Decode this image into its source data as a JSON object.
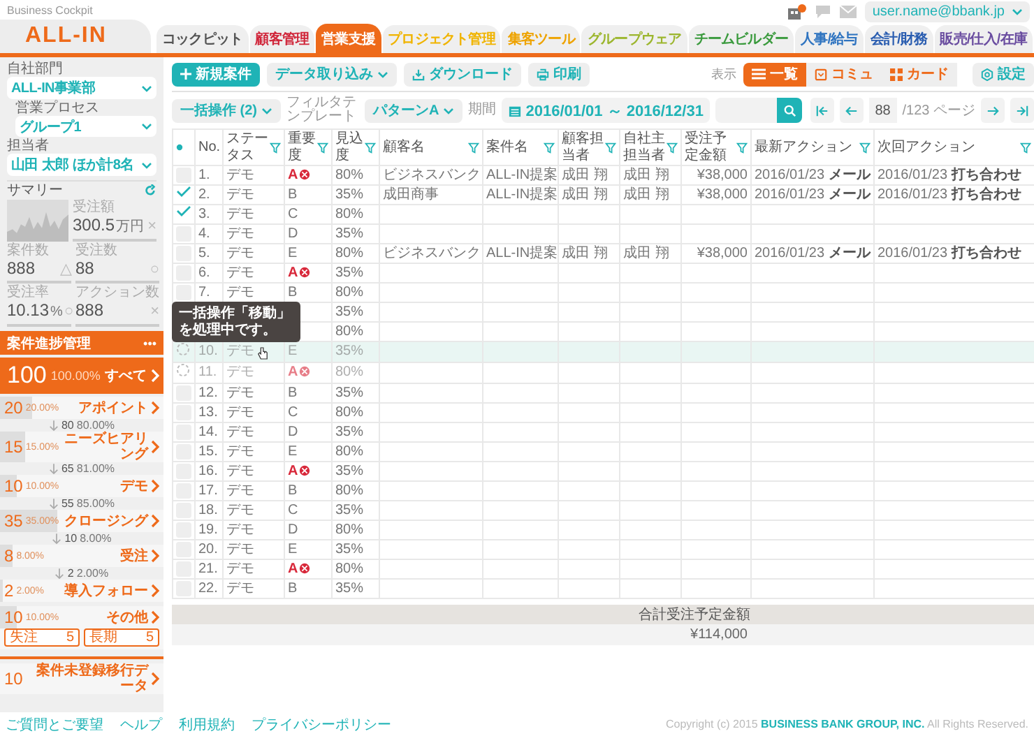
{
  "app": {
    "product": "Business Cockpit",
    "logo": "ALL-IN"
  },
  "tabs": [
    {
      "label": "コックピット",
      "selected": false,
      "color": "#555555"
    },
    {
      "label": "顧客管理",
      "selected": false,
      "color": "#d0263a"
    },
    {
      "label": "営業支援",
      "selected": true,
      "color": "#ee6a1a"
    },
    {
      "label": "プロジェクト管理",
      "selected": false,
      "color": "#f0b400"
    },
    {
      "label": "集客ツール",
      "selected": false,
      "color": "#eea300"
    },
    {
      "label": "グループウェア",
      "selected": false,
      "color": "#9cb62e"
    },
    {
      "label": "チームビルダー",
      "selected": false,
      "color": "#3a9a3d"
    },
    {
      "label": "人事/給与",
      "selected": false,
      "color": "#2f74c0"
    },
    {
      "label": "会計/財務",
      "selected": false,
      "color": "#2a5db0"
    },
    {
      "label": "販売/仕入/在庫",
      "selected": false,
      "color": "#6a4da0"
    }
  ],
  "user": "user.name@bbank.jp",
  "sidebar": {
    "filters": [
      {
        "label": "自社部門",
        "value": "ALL-IN事業部",
        "kind": "main"
      },
      {
        "label": "営業プロセス",
        "value": "グループ1",
        "kind": "sub"
      },
      {
        "label": "担当者",
        "value": "山田 太郎 ほか計8名",
        "kind": "main"
      }
    ],
    "summary": {
      "title": "サマリー",
      "amount": {
        "label": "受注額",
        "value": "300.5",
        "unit": "万円",
        "mark": "×"
      },
      "stats": [
        {
          "label": "案件数",
          "value": "888",
          "mark": "△"
        },
        {
          "label": "受注数",
          "value": "88",
          "mark": "○"
        },
        {
          "label": "受注率",
          "value": "10.13",
          "unit": "%",
          "mark": "○"
        },
        {
          "label": "アクション数",
          "value": "888",
          "mark": "×"
        }
      ]
    },
    "progress": {
      "title": "案件進捗管理",
      "menu": "•••",
      "total": {
        "count": "100",
        "percent": "100.00%",
        "label": "すべて"
      },
      "stages": [
        {
          "count": "20",
          "percent": "20.00%",
          "label": "アポイント",
          "level": 0.2,
          "next": {
            "count": "80",
            "percent": "80.00%"
          }
        },
        {
          "count": "15",
          "percent": "15.00%",
          "label": "ニーズヒアリング",
          "level": 0.15,
          "next": {
            "count": "65",
            "percent": "81.00%"
          }
        },
        {
          "count": "10",
          "percent": "10.00%",
          "label": "デモ",
          "level": 0.1,
          "next": {
            "count": "55",
            "percent": "85.00%"
          }
        },
        {
          "count": "35",
          "percent": "35.00%",
          "label": "クロージング",
          "level": 0.35,
          "next": {
            "count": "10",
            "percent": "8.00%"
          }
        },
        {
          "count": "8",
          "percent": "8.00%",
          "label": "受注",
          "level": 0.08,
          "next": {
            "count": "2",
            "percent": "2.00%"
          }
        },
        {
          "count": "2",
          "percent": "2.00%",
          "label": "導入フォロー",
          "level": 0.02
        },
        {
          "count": "10",
          "percent": "10.00%",
          "label": "その他",
          "level": 0.1,
          "subs": [
            {
              "label": "失注",
              "count": "5"
            },
            {
              "label": "長期",
              "count": "5"
            }
          ]
        }
      ],
      "unregistered": {
        "count": "10",
        "label": "案件未登録移行データ"
      }
    }
  },
  "toolbar": {
    "buttons": [
      {
        "label": "新規案件",
        "kind": "new"
      },
      {
        "label": "データ取り込み",
        "kind": "dropdown"
      },
      {
        "label": "ダウンロード",
        "kind": "download"
      },
      {
        "label": "印刷",
        "kind": "print"
      }
    ],
    "view_label": "表示",
    "views": [
      {
        "label": "一覧",
        "kind": "list",
        "selected": true
      },
      {
        "label": "コミュ",
        "kind": "comm",
        "selected": false
      },
      {
        "label": "カード",
        "kind": "card",
        "selected": false
      }
    ],
    "settings": "設定"
  },
  "filters": {
    "bulk": "一括操作 (2)",
    "template_label": "フィルタテンプレート",
    "template": "パターンA",
    "period_label": "期間",
    "period": "2016/01/01 ～ 2016/12/31",
    "page": "88",
    "page_total": "/123 ページ"
  },
  "table": {
    "columns": [
      {
        "kind": "select"
      },
      {
        "label": "No.",
        "filter": false
      },
      {
        "label": "ステータス",
        "filter": true
      },
      {
        "label": "重要度",
        "filter": true
      },
      {
        "label": "見込度",
        "filter": true
      },
      {
        "label": "顧客名",
        "filter": true
      },
      {
        "label": "案件名",
        "filter": true
      },
      {
        "label": "顧客担当者",
        "filter": true
      },
      {
        "label": "自社主担当者",
        "filter": true
      },
      {
        "label": "受注予定金額",
        "filter": true
      },
      {
        "label": "最新アクション",
        "filter": true
      },
      {
        "label": "次回アクション",
        "filter": true
      }
    ],
    "rows": [
      {
        "no": "1.",
        "status": "デモ",
        "grade": "A",
        "urgent": true,
        "prob": "80%",
        "customer": "ビジネスバンク",
        "project": "ALL-IN提案",
        "contact": "成田 翔",
        "owner": "成田 翔",
        "amount": "¥38,000",
        "last_action": "2016/01/23 **メール**",
        "next_action": "2016/01/23 **打ち合わせ**",
        "checked": false,
        "processing": false,
        "hovered": false
      },
      {
        "no": "2.",
        "status": "デモ",
        "grade": "B",
        "urgent": false,
        "prob": "35%",
        "customer": "成田商事",
        "project": "ALL-IN提案",
        "contact": "成田 翔",
        "owner": "成田 翔",
        "amount": "¥38,000",
        "last_action": "2016/01/23 **メール**",
        "next_action": "2016/01/23 **打ち合わせ**",
        "checked": true,
        "processing": false,
        "hovered": false
      },
      {
        "no": "3.",
        "status": "デモ",
        "grade": "C",
        "urgent": false,
        "prob": "80%",
        "checked": true,
        "processing": false,
        "hovered": false
      },
      {
        "no": "4.",
        "status": "デモ",
        "grade": "D",
        "urgent": false,
        "prob": "35%",
        "checked": false,
        "processing": false,
        "hovered": false
      },
      {
        "no": "5.",
        "status": "デモ",
        "grade": "E",
        "urgent": false,
        "prob": "80%",
        "customer": "ビジネスバンク",
        "project": "ALL-IN提案",
        "contact": "成田 翔",
        "owner": "成田 翔",
        "amount": "¥38,000",
        "last_action": "2016/01/23 **メール**",
        "next_action": "2016/01/23 **打ち合わせ**",
        "checked": false,
        "processing": false,
        "hovered": false
      },
      {
        "no": "6.",
        "status": "デモ",
        "grade": "A",
        "urgent": true,
        "prob": "35%",
        "checked": false,
        "processing": false,
        "hovered": false
      },
      {
        "no": "7.",
        "status": "デモ",
        "grade": "B",
        "urgent": false,
        "prob": "80%",
        "checked": false,
        "processing": false,
        "hovered": false
      },
      {
        "prob": "35%",
        "processing": false,
        "hovered": false,
        "tooltip": "一括操作「移動」を処理中です。"
      },
      {
        "prob": "80%",
        "processing": false,
        "hovered": false
      },
      {
        "no": "10.",
        "status": "デモ",
        "grade": "E",
        "urgent": false,
        "prob": "35%",
        "processing": true,
        "hovered": true
      },
      {
        "no": "11.",
        "status": "デモ",
        "grade": "A",
        "urgent": true,
        "prob": "80%",
        "processing": true,
        "hovered": false
      },
      {
        "no": "12.",
        "status": "デモ",
        "grade": "B",
        "urgent": false,
        "prob": "35%",
        "checked": false,
        "processing": false,
        "hovered": false
      },
      {
        "no": "13.",
        "status": "デモ",
        "grade": "C",
        "urgent": false,
        "prob": "80%",
        "checked": false,
        "processing": false,
        "hovered": false
      },
      {
        "no": "14.",
        "status": "デモ",
        "grade": "D",
        "urgent": false,
        "prob": "35%",
        "checked": false,
        "processing": false,
        "hovered": false
      },
      {
        "no": "15.",
        "status": "デモ",
        "grade": "E",
        "urgent": false,
        "prob": "80%",
        "checked": false,
        "processing": false,
        "hovered": false
      },
      {
        "no": "16.",
        "status": "デモ",
        "grade": "A",
        "urgent": true,
        "prob": "35%",
        "checked": false,
        "processing": false,
        "hovered": false
      },
      {
        "no": "17.",
        "status": "デモ",
        "grade": "B",
        "urgent": false,
        "prob": "80%",
        "checked": false,
        "processing": false,
        "hovered": false
      },
      {
        "no": "18.",
        "status": "デモ",
        "grade": "C",
        "urgent": false,
        "prob": "35%",
        "checked": false,
        "processing": false,
        "hovered": false
      },
      {
        "no": "19.",
        "status": "デモ",
        "grade": "D",
        "urgent": false,
        "prob": "80%",
        "checked": false,
        "processing": false,
        "hovered": false
      },
      {
        "no": "20.",
        "status": "デモ",
        "grade": "E",
        "urgent": false,
        "prob": "35%",
        "checked": false,
        "processing": false,
        "hovered": false
      },
      {
        "no": "21.",
        "status": "デモ",
        "grade": "A",
        "urgent": true,
        "prob": "80%",
        "checked": false,
        "processing": false,
        "hovered": false
      },
      {
        "no": "22.",
        "status": "デモ",
        "grade": "B",
        "urgent": false,
        "prob": "35%",
        "checked": false,
        "processing": false,
        "hovered": false
      }
    ]
  },
  "totals": {
    "label": "合計受注予定金額",
    "value": "¥114,000"
  },
  "footer": {
    "links": [
      "ご質問とご要望",
      "ヘルプ",
      "利用規約",
      "プライバシーポリシー"
    ],
    "copyright": "Copyright (c) 2015 **BUSINESS BANK GROUP, INC.** All Rights Reserved."
  }
}
